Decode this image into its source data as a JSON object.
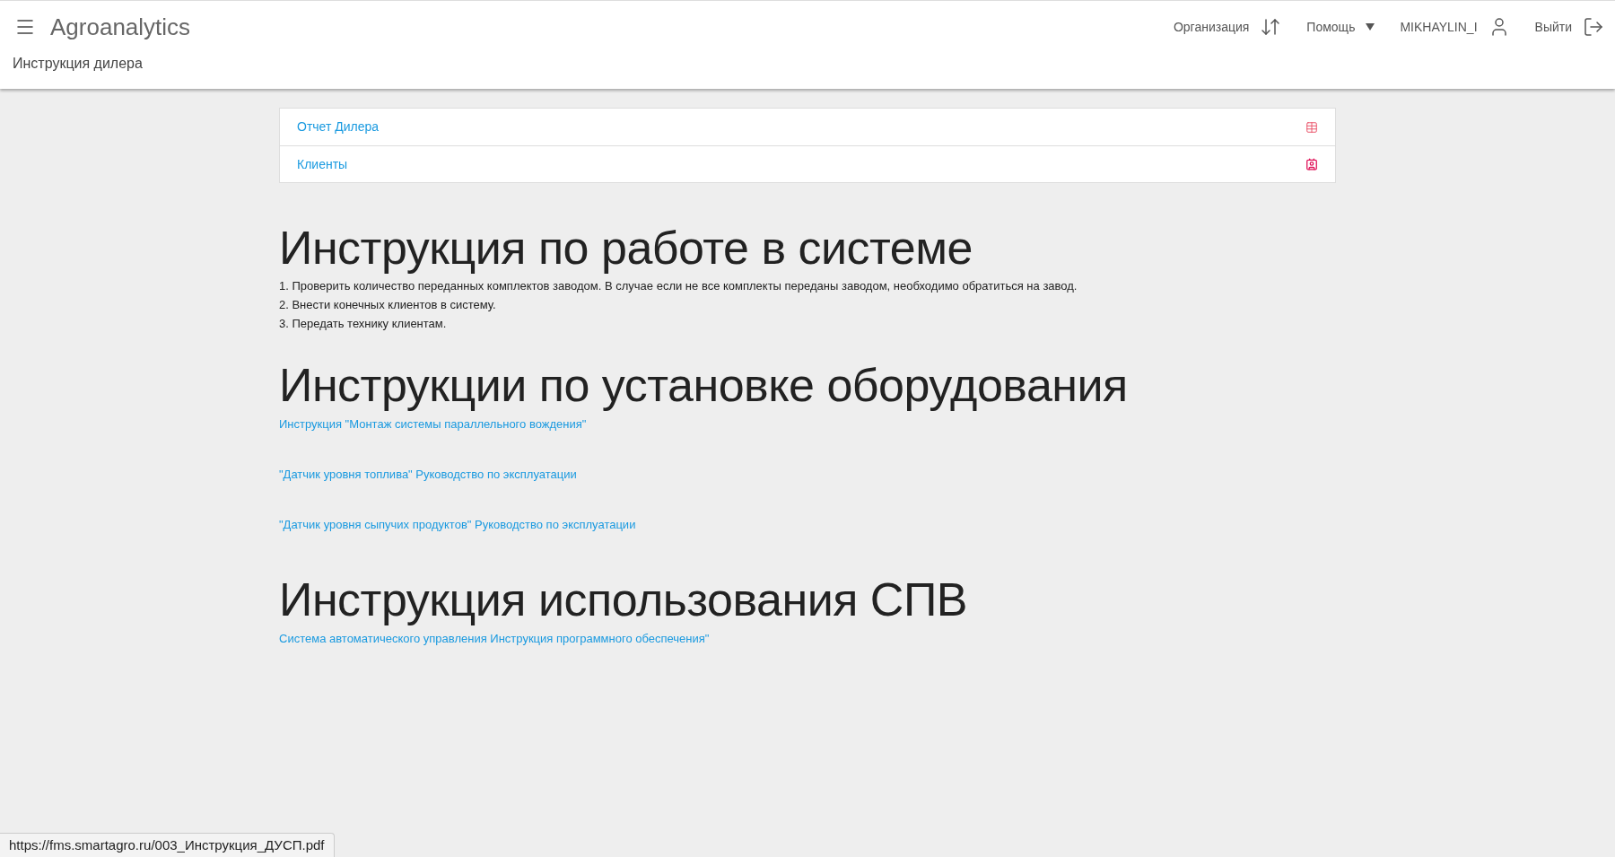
{
  "header": {
    "app_title": "Agroanalytics",
    "page_title": "Инструкция дилера",
    "actions": [
      {
        "kind": "org",
        "label": "Организация"
      },
      {
        "kind": "help",
        "label": "Помощь"
      },
      {
        "kind": "user",
        "label": "MIKHAYLIN_I"
      },
      {
        "kind": "logout",
        "label": "Выйти"
      }
    ]
  },
  "menu_items": [
    {
      "label": "Отчет Дилера",
      "kind": "table"
    },
    {
      "label": "Клиенты",
      "kind": "contacts"
    }
  ],
  "sections": [
    {
      "title": "Инструкция по работе в системе",
      "lines": [
        "1. Проверить количество переданных комплектов заводом. В случае если не все комплекты переданы заводом, необходимо обратиться на завод.",
        "2. Внести конечных клиентов в систему.",
        "3. Передать технику клиентам."
      ]
    },
    {
      "title": "Инструкции по установке оборудования",
      "links": [
        "Инструкция \"Монтаж системы параллельного вождения\"",
        "\"Датчик уровня топлива\" Руководство по эксплуатации",
        "\"Датчик уровня сыпучих продуктов\" Руководство по эксплуатации"
      ]
    },
    {
      "title": "Инструкция использования СПВ",
      "links": [
        "Система автоматического управления Инструкция программного обеспечения\""
      ]
    }
  ],
  "status_url": "https://fms.smartagro.ru/003_Инструкция_ДУСП.pdf"
}
